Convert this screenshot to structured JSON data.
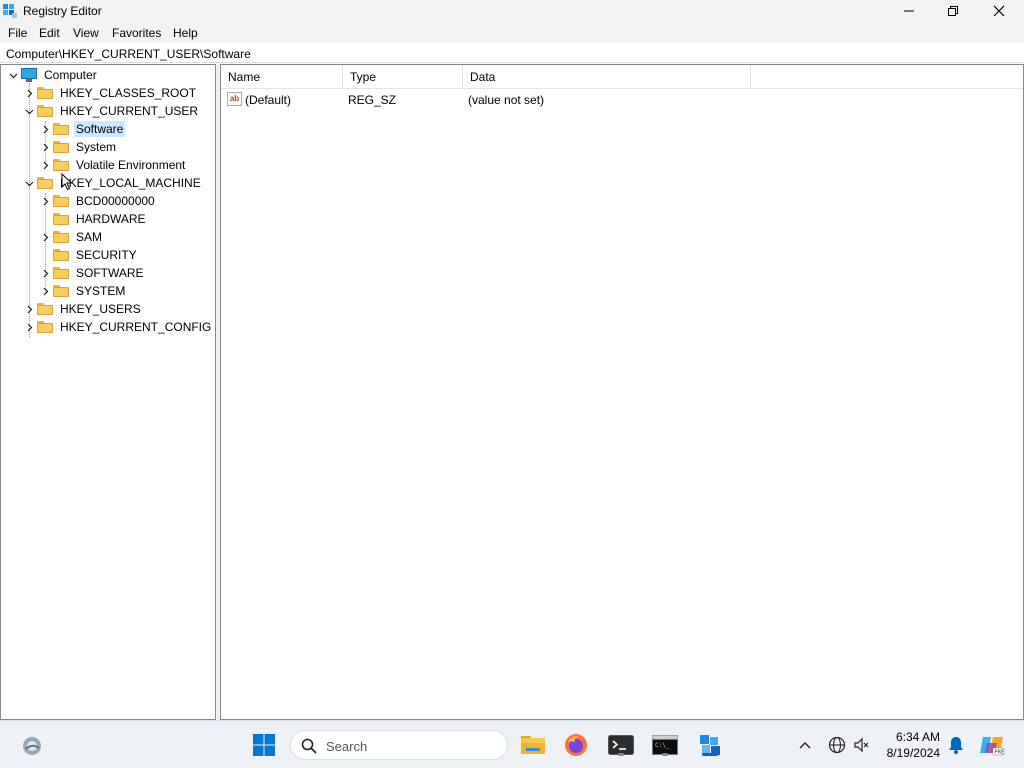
{
  "window": {
    "title": "Registry Editor"
  },
  "menu": [
    "File",
    "Edit",
    "View",
    "Favorites",
    "Help"
  ],
  "address": "Computer\\HKEY_CURRENT_USER\\Software",
  "tree": {
    "root": "Computer",
    "hkcr": "HKEY_CLASSES_ROOT",
    "hkcu": "HKEY_CURRENT_USER",
    "hkcu_children": [
      "Software",
      "System",
      "Volatile Environment"
    ],
    "hklm": "HKEY_LOCAL_MACHINE",
    "hklm_children": [
      "BCD00000000",
      "HARDWARE",
      "SAM",
      "SECURITY",
      "SOFTWARE",
      "SYSTEM"
    ],
    "hku": "HKEY_USERS",
    "hkcc": "HKEY_CURRENT_CONFIG",
    "selected": "Software"
  },
  "list": {
    "columns": [
      "Name",
      "Type",
      "Data"
    ],
    "rows": [
      {
        "name": "(Default)",
        "type": "REG_SZ",
        "data": "(value not set)",
        "icon": "string-value-icon"
      }
    ]
  },
  "taskbar": {
    "search_placeholder": "Search",
    "time": "6:34 AM",
    "date": "8/19/2024",
    "icons": [
      "widgets-icon",
      "start-icon",
      "file-explorer-icon",
      "firefox-icon",
      "terminal-icon",
      "command-prompt-icon",
      "registry-editor-icon",
      "chevron-up-icon",
      "network-icon",
      "sound-off-icon",
      "notification-bell-icon",
      "copilot-icon"
    ]
  },
  "colors": {
    "selection": "#cce8ff",
    "folder": "#f8cf58",
    "accent": "#0067c0"
  }
}
